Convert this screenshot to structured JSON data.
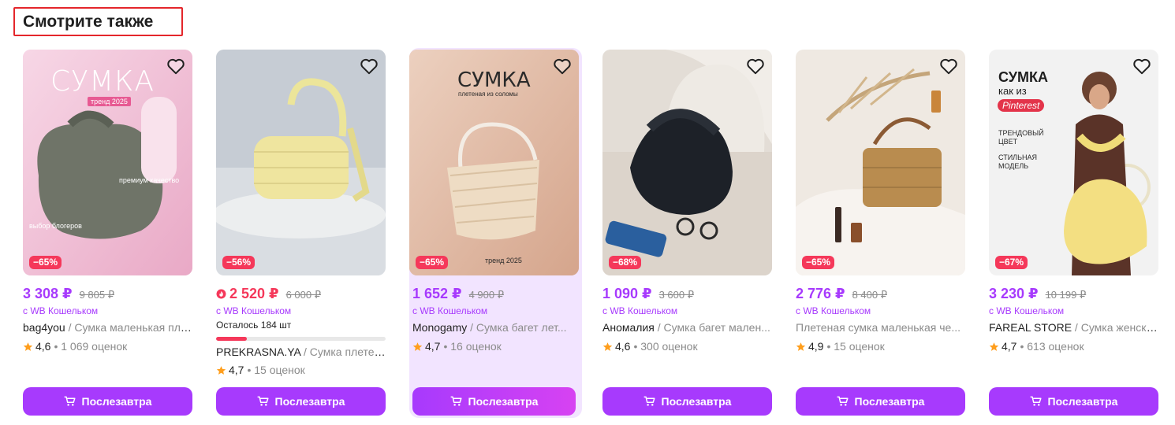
{
  "section": {
    "title": "Смотрите также"
  },
  "icons": {
    "favorite": "heart-outline-icon",
    "cart": "cart-icon",
    "star": "star-icon",
    "fire": "fire-icon"
  },
  "colors": {
    "accent": "#a73afd",
    "discount": "#f5385a",
    "star": "#ff9e1c",
    "highlight_bg": "#f2e4ff"
  },
  "products": [
    {
      "discount": "−65%",
      "price": "3 308 ₽",
      "old_price": "9 805 ₽",
      "wallet": "с WB Кошельком",
      "seller": "bag4you",
      "description": " / Сумка маленькая пле...",
      "rating": "4,6",
      "reviews": "• 1 069 оценок",
      "button": "Послезавтра",
      "overlay": {
        "title": "СУМКА",
        "badge": "тренд 2025",
        "line1": "премиум качество",
        "line2": "выбор блогеров"
      }
    },
    {
      "discount": "−56%",
      "price": "2 520 ₽",
      "old_price": "6 000 ₽",
      "wallet": "с WB Кошельком",
      "remains": "Осталось 184 шт",
      "remains_fraction": 0.18,
      "seller": "PREKRASNA.YA",
      "description": " / Сумка плетен...",
      "rating": "4,7",
      "reviews": "• 15 оценок",
      "button": "Послезавтра"
    },
    {
      "discount": "−65%",
      "price": "1 652 ₽",
      "old_price": "4 900 ₽",
      "wallet": "с WB Кошельком",
      "seller": "Monogamy",
      "description": " / Сумка багет лет...",
      "rating": "4,7",
      "reviews": "• 16 оценок",
      "button": "Послезавтра",
      "overlay": {
        "title": "СУМКА",
        "subtitle": "плетеная из соломы",
        "line1": "тренд 2025"
      }
    },
    {
      "discount": "−68%",
      "price": "1 090 ₽",
      "old_price": "3 600 ₽",
      "wallet": "с WB Кошельком",
      "seller": "Аномалия",
      "description": " / Сумка багет мален...",
      "rating": "4,6",
      "reviews": "• 300 оценок",
      "button": "Послезавтра"
    },
    {
      "discount": "−65%",
      "price": "2 776 ₽",
      "old_price": "8 400 ₽",
      "wallet": "с WB Кошельком",
      "seller": "",
      "description": "Плетеная сумка маленькая че...",
      "rating": "4,9",
      "reviews": "• 15 оценок",
      "button": "Послезавтра"
    },
    {
      "discount": "−67%",
      "price": "3 230 ₽",
      "old_price": "10 199 ₽",
      "wallet": "с WB Кошельком",
      "seller": "FAREAL STORE",
      "description": " / Сумка женска...",
      "rating": "4,7",
      "reviews": "• 613 оценок",
      "button": "Послезавтра",
      "overlay": {
        "title": "СУМКА",
        "subtitle": "как из",
        "badge": "Pinterest",
        "line1": "ТРЕНДОВЫЙ",
        "line2": "ЦВЕТ",
        "line3": "СТИЛЬНАЯ",
        "line4": "МОДЕЛЬ"
      }
    }
  ]
}
